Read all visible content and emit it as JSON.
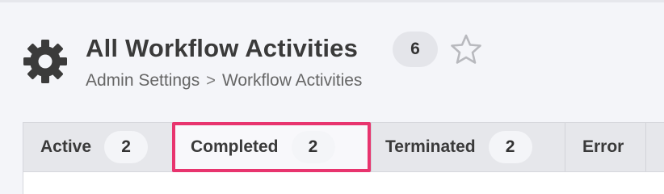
{
  "header": {
    "title": "All Workflow Activities",
    "count": "6",
    "icon": "gear-icon",
    "favorite_icon": "star-icon"
  },
  "breadcrumb": {
    "items": [
      "Admin Settings",
      "Workflow Activities"
    ],
    "separator": ">"
  },
  "tabs": [
    {
      "label": "Active",
      "count": "2"
    },
    {
      "label": "Completed",
      "count": "2",
      "selected": true
    },
    {
      "label": "Terminated",
      "count": "2"
    },
    {
      "label": "Error"
    }
  ],
  "colors": {
    "highlight": "#e8346e",
    "page_bg": "#f4f5f9",
    "tabbar_bg": "#e6e7eb",
    "badge_bg": "#e4e5ea"
  }
}
